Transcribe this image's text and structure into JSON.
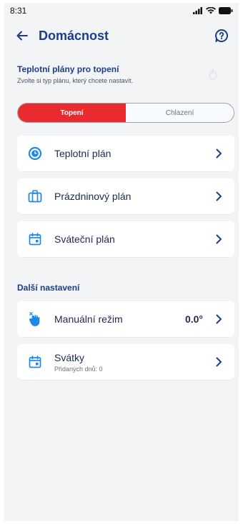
{
  "status": {
    "time": "8:31"
  },
  "header": {
    "title": "Domácnost"
  },
  "plans": {
    "title": "Teplotní plány pro topení",
    "subtitle": "Zvolte si typ plánu, který chcete nastavit."
  },
  "mode_toggle": {
    "heating_label": "Topení",
    "cooling_label": "Chlazení",
    "active": "heating"
  },
  "plan_items": [
    {
      "label": "Teplotní plán",
      "icon": "clock-icon"
    },
    {
      "label": "Prázdninový plán",
      "icon": "luggage-icon"
    },
    {
      "label": "Sváteční plán",
      "icon": "calendar-icon"
    }
  ],
  "more_settings": {
    "title": "Další nastavení",
    "manual_mode": {
      "label": "Manuální režim",
      "value": "0.0°",
      "icon": "hand-icon"
    },
    "holidays": {
      "label": "Svátky",
      "sub": "Přidaných dnů: 0",
      "icon": "calendar-icon"
    }
  },
  "colors": {
    "accent": "#e92a2f",
    "brand": "#1c3c8c"
  }
}
